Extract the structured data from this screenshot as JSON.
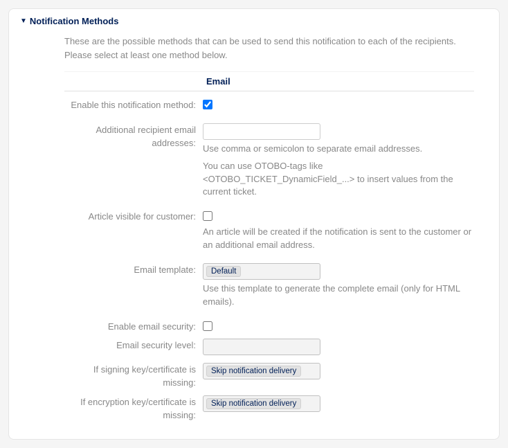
{
  "panel": {
    "title": "Notification Methods",
    "intro": "These are the possible methods that can be used to send this notification to each of the recipients. Please select at least one method below.",
    "columnHeader": "Email"
  },
  "fields": {
    "enableMethod": {
      "label": "Enable this notification method:",
      "checked": true
    },
    "additionalRecipients": {
      "label": "Additional recipient email addresses:",
      "value": "",
      "help1": "Use comma or semicolon to separate email addresses.",
      "help2": "You can use OTOBO-tags like <OTOBO_TICKET_DynamicField_...> to insert values from the current ticket."
    },
    "articleVisible": {
      "label": "Article visible for customer:",
      "checked": false,
      "help": "An article will be created if the notification is sent to the customer or an additional email address."
    },
    "emailTemplate": {
      "label": "Email template:",
      "value": "Default",
      "help": "Use this template to generate the complete email (only for HTML emails)."
    },
    "enableSecurity": {
      "label": "Enable email security:",
      "checked": false
    },
    "securityLevel": {
      "label": "Email security level:",
      "value": ""
    },
    "signingMissing": {
      "label": "If signing key/certificate is missing:",
      "value": "Skip notification delivery"
    },
    "encryptionMissing": {
      "label": "If encryption key/certificate is missing:",
      "value": "Skip notification delivery"
    }
  }
}
